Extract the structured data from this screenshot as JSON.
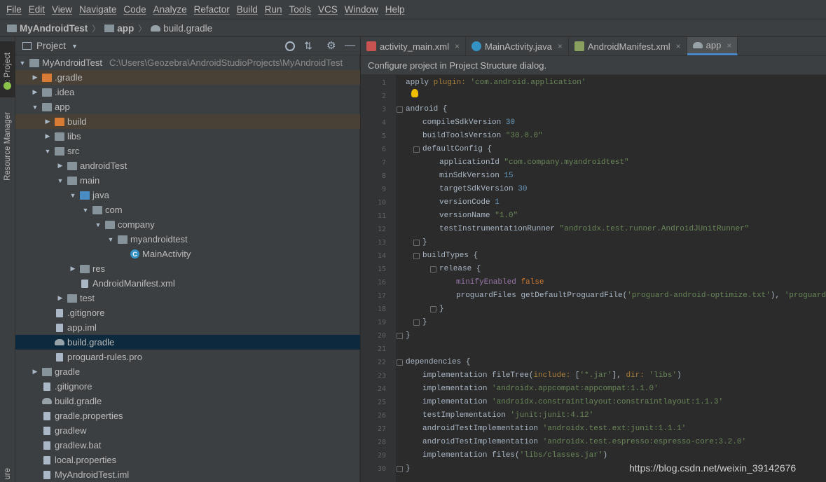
{
  "menu": [
    "File",
    "Edit",
    "View",
    "Navigate",
    "Code",
    "Analyze",
    "Refactor",
    "Build",
    "Run",
    "Tools",
    "VCS",
    "Window",
    "Help"
  ],
  "breadcrumb": {
    "project": "MyAndroidTest",
    "module": "app",
    "file": "build.gradle"
  },
  "side_tabs": {
    "project": "1: Project",
    "resource_manager": "Resource Manager",
    "structure": "ure"
  },
  "project_panel": {
    "title": "Project"
  },
  "tree": [
    {
      "label": "MyAndroidTest",
      "path": "C:\\Users\\Geozebra\\AndroidStudioProjects\\MyAndroidTest",
      "depth": 0,
      "arrow": "▼",
      "icon": "folder"
    },
    {
      "label": ".gradle",
      "depth": 1,
      "arrow": "▶",
      "icon": "folder-orange"
    },
    {
      "label": ".idea",
      "depth": 1,
      "arrow": "▶",
      "icon": "folder"
    },
    {
      "label": "app",
      "depth": 1,
      "arrow": "▼",
      "icon": "folder"
    },
    {
      "label": "build",
      "depth": 2,
      "arrow": "▶",
      "icon": "folder-orange"
    },
    {
      "label": "libs",
      "depth": 2,
      "arrow": "▶",
      "icon": "folder"
    },
    {
      "label": "src",
      "depth": 2,
      "arrow": "▼",
      "icon": "folder"
    },
    {
      "label": "androidTest",
      "depth": 3,
      "arrow": "▶",
      "icon": "folder"
    },
    {
      "label": "main",
      "depth": 3,
      "arrow": "▼",
      "icon": "folder"
    },
    {
      "label": "java",
      "depth": 4,
      "arrow": "▼",
      "icon": "folder-blue"
    },
    {
      "label": "com",
      "depth": 5,
      "arrow": "▼",
      "icon": "folder"
    },
    {
      "label": "company",
      "depth": 6,
      "arrow": "▼",
      "icon": "folder"
    },
    {
      "label": "myandroidtest",
      "depth": 7,
      "arrow": "▼",
      "icon": "folder"
    },
    {
      "label": "MainActivity",
      "depth": 8,
      "arrow": "",
      "icon": "class"
    },
    {
      "label": "res",
      "depth": 4,
      "arrow": "▶",
      "icon": "folder"
    },
    {
      "label": "AndroidManifest.xml",
      "depth": 4,
      "arrow": "",
      "icon": "file"
    },
    {
      "label": "test",
      "depth": 3,
      "arrow": "▶",
      "icon": "folder"
    },
    {
      "label": ".gitignore",
      "depth": 2,
      "arrow": "",
      "icon": "file"
    },
    {
      "label": "app.iml",
      "depth": 2,
      "arrow": "",
      "icon": "file"
    },
    {
      "label": "build.gradle",
      "depth": 2,
      "arrow": "",
      "icon": "gradle"
    },
    {
      "label": "proguard-rules.pro",
      "depth": 2,
      "arrow": "",
      "icon": "file"
    },
    {
      "label": "gradle",
      "depth": 1,
      "arrow": "▶",
      "icon": "folder"
    },
    {
      "label": ".gitignore",
      "depth": 1,
      "arrow": "",
      "icon": "file"
    },
    {
      "label": "build.gradle",
      "depth": 1,
      "arrow": "",
      "icon": "gradle"
    },
    {
      "label": "gradle.properties",
      "depth": 1,
      "arrow": "",
      "icon": "file"
    },
    {
      "label": "gradlew",
      "depth": 1,
      "arrow": "",
      "icon": "file"
    },
    {
      "label": "gradlew.bat",
      "depth": 1,
      "arrow": "",
      "icon": "file"
    },
    {
      "label": "local.properties",
      "depth": 1,
      "arrow": "",
      "icon": "file"
    },
    {
      "label": "MyAndroidTest.iml",
      "depth": 1,
      "arrow": "",
      "icon": "file"
    }
  ],
  "tabs": [
    {
      "label": "activity_main.xml",
      "icon": "xml"
    },
    {
      "label": "MainActivity.java",
      "icon": "class"
    },
    {
      "label": "AndroidManifest.xml",
      "icon": "manifest"
    },
    {
      "label": "app",
      "icon": "gradle",
      "active": true
    }
  ],
  "banner": "Configure project in Project Structure dialog.",
  "code_lines": [
    {
      "n": "1",
      "html": "apply <span class='arg'>plugin:</span> <span class='str'>'com.android.application'</span>",
      "indent": 0
    },
    {
      "n": "2",
      "html": "",
      "indent": 0
    },
    {
      "n": "3",
      "html": "android {",
      "indent": 0,
      "fold": true
    },
    {
      "n": "4",
      "html": "compileSdkVersion <span class='num'>30</span>",
      "indent": 1
    },
    {
      "n": "5",
      "html": "buildToolsVersion <span class='str'>\"30.0.0\"</span>",
      "indent": 1
    },
    {
      "n": "6",
      "html": "defaultConfig {",
      "indent": 1,
      "fold": true
    },
    {
      "n": "7",
      "html": "applicationId <span class='str'>\"com.company.myandroidtest\"</span>",
      "indent": 2
    },
    {
      "n": "8",
      "html": "minSdkVersion <span class='num'>15</span>",
      "indent": 2
    },
    {
      "n": "9",
      "html": "targetSdkVersion <span class='num'>30</span>",
      "indent": 2
    },
    {
      "n": "10",
      "html": "versionCode <span class='num'>1</span>",
      "indent": 2
    },
    {
      "n": "11",
      "html": "versionName <span class='str'>\"1.0\"</span>",
      "indent": 2
    },
    {
      "n": "12",
      "html": "testInstrumentationRunner <span class='str'>\"androidx.test.runner.AndroidJUnitRunner\"</span>",
      "indent": 2
    },
    {
      "n": "13",
      "html": "}",
      "indent": 1,
      "fold": true
    },
    {
      "n": "14",
      "html": "buildTypes {",
      "indent": 1,
      "fold": true
    },
    {
      "n": "15",
      "html": "release {",
      "indent": 2,
      "fold": true
    },
    {
      "n": "16",
      "html": "<span class='purple'>minifyEnabled</span> <span class='kw'>false</span>",
      "indent": 3
    },
    {
      "n": "17",
      "html": "proguardFiles getDefaultProguardFile(<span class='str'>'proguard-android-optimize.txt'</span>), <span class='str'>'proguard-rules.pro'</span>",
      "indent": 3
    },
    {
      "n": "18",
      "html": "}",
      "indent": 2,
      "fold": true
    },
    {
      "n": "19",
      "html": "}",
      "indent": 1,
      "fold": true
    },
    {
      "n": "20",
      "html": "}",
      "indent": 0,
      "fold": true
    },
    {
      "n": "21",
      "html": "",
      "indent": 0
    },
    {
      "n": "22",
      "html": "dependencies {",
      "indent": 0,
      "fold": true
    },
    {
      "n": "23",
      "html": "implementation fileTree(<span class='arg'>include:</span> [<span class='str'>'*.jar'</span>], <span class='arg'>dir:</span> <span class='str'>'libs'</span>)",
      "indent": 1
    },
    {
      "n": "24",
      "html": "implementation <span class='str'>'androidx.appcompat:appcompat:1.1.0'</span>",
      "indent": 1
    },
    {
      "n": "25",
      "html": "implementation <span class='str'>'androidx.constraintlayout:constraintlayout:1.1.3'</span>",
      "indent": 1
    },
    {
      "n": "26",
      "html": "testImplementation <span class='str'>'junit:junit:4.12'</span>",
      "indent": 1
    },
    {
      "n": "27",
      "html": "androidTestImplementation <span class='str'>'androidx.test.ext:junit:1.1.1'</span>",
      "indent": 1
    },
    {
      "n": "28",
      "html": "androidTestImplementation <span class='str'>'androidx.test.espresso:espresso-core:3.2.0'</span>",
      "indent": 1
    },
    {
      "n": "29",
      "html": "implementation files(<span class='str'>'libs/classes.jar'</span>)",
      "indent": 1
    },
    {
      "n": "30",
      "html": "}",
      "indent": 0,
      "fold": true
    }
  ],
  "watermark": "https://blog.csdn.net/weixin_39142676",
  "colors": {
    "background": "#2b2b2b",
    "panel": "#3c3f41",
    "selection": "#0d293e",
    "accent": "#4a88c7"
  }
}
